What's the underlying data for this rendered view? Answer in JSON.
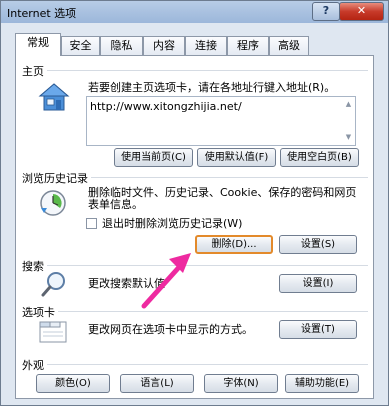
{
  "window": {
    "title": "Internet 选项",
    "help_label": "?",
    "close_label": "✕"
  },
  "tabs": [
    {
      "label": "常规",
      "active": true
    },
    {
      "label": "安全"
    },
    {
      "label": "隐私"
    },
    {
      "label": "内容"
    },
    {
      "label": "连接"
    },
    {
      "label": "程序"
    },
    {
      "label": "高级"
    }
  ],
  "homepage": {
    "group_label": "主页",
    "description": "若要创建主页选项卡，请在各地址行键入地址(R)。",
    "url": "http://www.xitongzhijia.net/",
    "buttons": [
      "使用当前页(C)",
      "使用默认值(F)",
      "使用空白页(B)"
    ],
    "icon": "house-icon"
  },
  "history": {
    "group_label": "浏览历史记录",
    "description_line1": "删除临时文件、历史记录、Cookie、保存的密码和网页",
    "description_line2": "表单信息。",
    "checkbox_label": "退出时删除浏览历史记录(W)",
    "checkbox_checked": false,
    "delete_button": "删除(D)...",
    "settings_button": "设置(S)",
    "icon": "history-clock-icon"
  },
  "search": {
    "group_label": "搜索",
    "description": "更改搜索默认值",
    "settings_button": "设置(I)",
    "icon": "magnifier-icon"
  },
  "tabs_section": {
    "group_label": "选项卡",
    "description": "更改网页在选项卡中显示的方式。",
    "settings_button": "设置(T)",
    "icon": "tabbed-window-icon"
  },
  "appearance": {
    "group_label": "外观",
    "buttons": [
      "颜色(O)",
      "语言(L)",
      "字体(N)",
      "辅助功能(E)"
    ]
  },
  "colors": {
    "titlebar": "#a9c1e0",
    "close_button": "#c73a2a",
    "focus_border": "#e38a2b",
    "annotation_arrow": "#ee2aa0"
  }
}
